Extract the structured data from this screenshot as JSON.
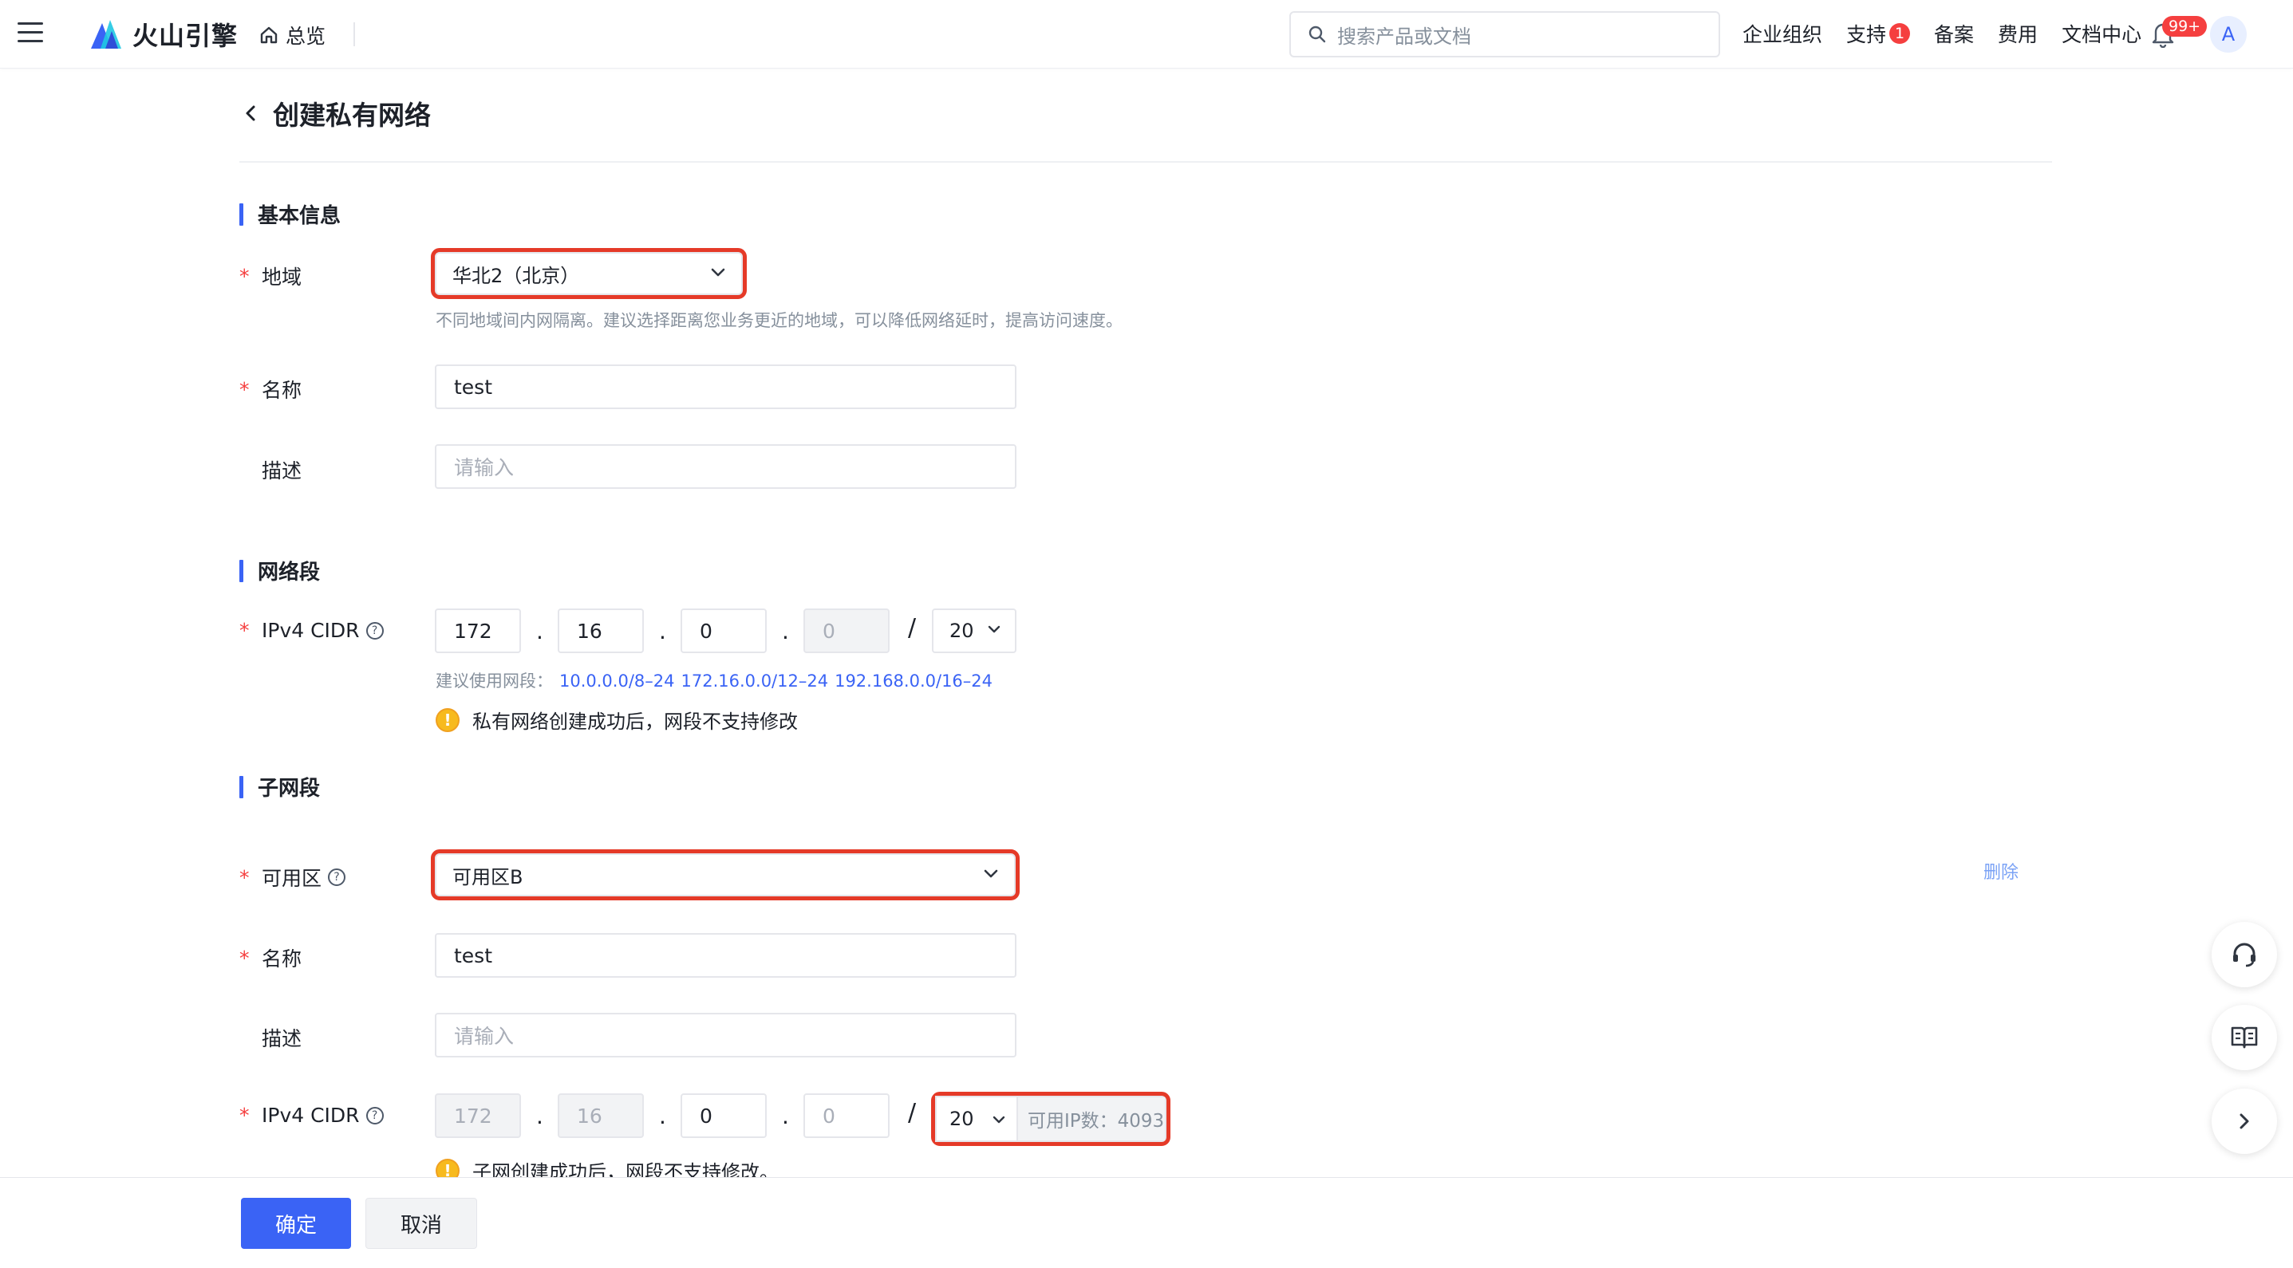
{
  "topnav": {
    "brand": "火山引擎",
    "home_label": "总览",
    "search_placeholder": "搜索产品或文档",
    "links": [
      {
        "label": "企业组织"
      },
      {
        "label": "支持",
        "badge": "1"
      },
      {
        "label": "备案"
      },
      {
        "label": "费用"
      },
      {
        "label": "文档中心"
      }
    ],
    "notification_badge": "99+",
    "avatar_letter": "A"
  },
  "page": {
    "title": "创建私有网络"
  },
  "basic": {
    "section_title": "基本信息",
    "region_label": "地域",
    "region_value": "华北2（北京）",
    "region_hint": "不同地域间内网隔离。建议选择距离您业务更近的地域，可以降低网络延时，提高访问速度。",
    "name_label": "名称",
    "name_value": "test",
    "desc_label": "描述",
    "desc_placeholder": "请输入"
  },
  "network": {
    "section_title": "网络段",
    "cidr_label": "IPv4 CIDR",
    "octets": [
      "172",
      "16",
      "0",
      "0"
    ],
    "prefix": "20",
    "suggest_label": "建议使用网段：",
    "suggestions": [
      "10.0.0.0/8–24",
      "172.16.0.0/12–24",
      "192.168.0.0/16–24"
    ],
    "warning": "私有网络创建成功后，网段不支持修改"
  },
  "subnet": {
    "section_title": "子网段",
    "zone_label": "可用区",
    "zone_value": "可用区B",
    "delete_label": "删除",
    "name_label": "名称",
    "name_value": "test",
    "desc_label": "描述",
    "desc_placeholder": "请输入",
    "cidr_label": "IPv4 CIDR",
    "octets": [
      "172",
      "16",
      "0",
      "0"
    ],
    "prefix": "20",
    "available_ip": "可用IP数：4093",
    "warning": "子网创建成功后，网段不支持修改。"
  },
  "footer": {
    "confirm": "确定",
    "cancel": "取消"
  },
  "colors": {
    "primary": "#3a63f5",
    "highlight": "#e53a28",
    "required": "#f53f3f",
    "warning": "#f7ba1e"
  }
}
